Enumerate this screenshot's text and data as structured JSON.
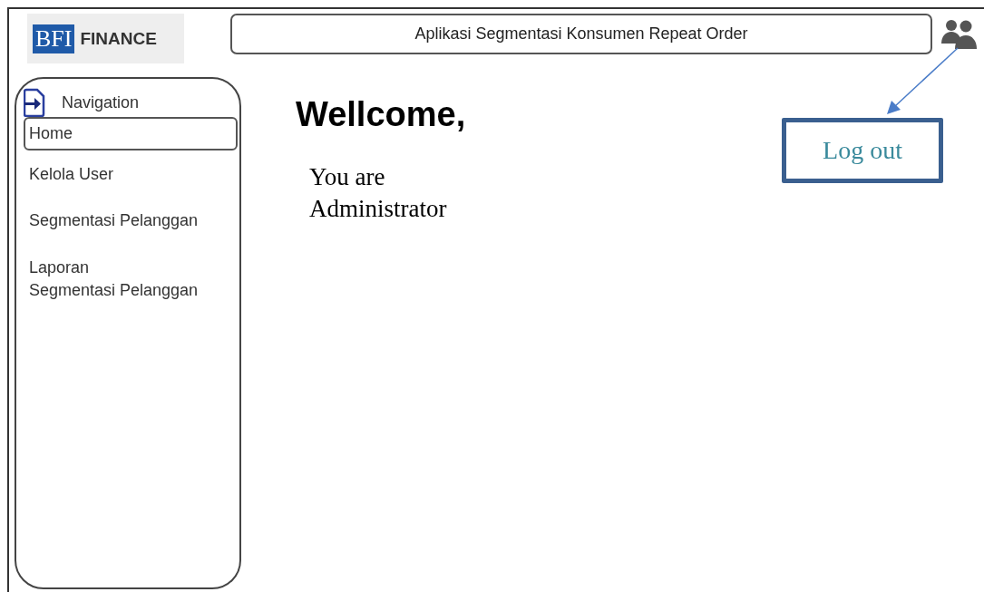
{
  "logo": {
    "mark": "BFI",
    "name": "FINANCE"
  },
  "app_title": "Aplikasi Segmentasi Konsumen Repeat Order",
  "navigation": {
    "title": "Navigation",
    "items": [
      {
        "label": "Home",
        "selected": true
      },
      {
        "label": "Kelola User",
        "selected": false
      },
      {
        "label": "Segmentasi Pelanggan",
        "selected": false
      },
      {
        "label": "Laporan\nSegmentasi Pelanggan",
        "selected": false
      }
    ]
  },
  "heading": "Wellcome,",
  "role_text": "You are\nAdministrator",
  "logout_button": "Log out"
}
